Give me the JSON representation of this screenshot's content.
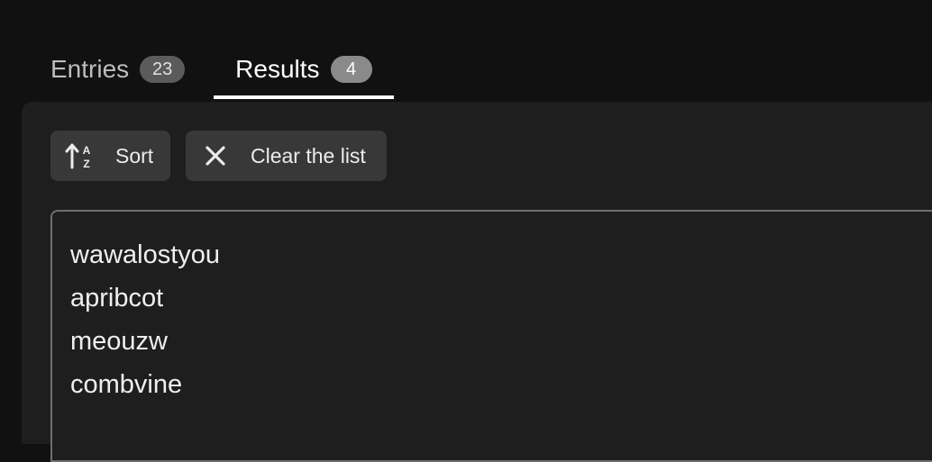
{
  "tabs": [
    {
      "label": "Entries",
      "count": "23",
      "active": false
    },
    {
      "label": "Results",
      "count": "4",
      "active": true
    }
  ],
  "toolbar": {
    "sort_label": "Sort",
    "sort_icon": "sort-alpha-icon",
    "clear_label": "Clear the list",
    "clear_icon": "close-icon"
  },
  "results": {
    "lines": [
      "wawalostyou",
      "apribcot",
      "meouzw",
      "combvine"
    ]
  },
  "colors": {
    "background": "#111111",
    "panel": "#1e1e1e",
    "button": "#383838",
    "accent_underline": "#ffffff"
  }
}
